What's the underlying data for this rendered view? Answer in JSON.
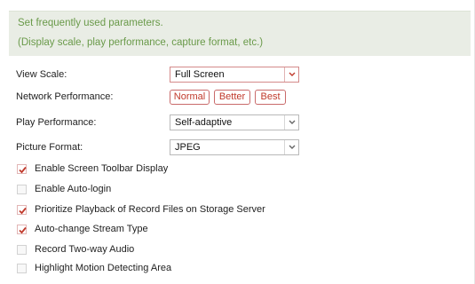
{
  "info": {
    "line1": "Set frequently used parameters.",
    "line2": "(Display scale, play performance, capture format, etc.)"
  },
  "view_scale": {
    "label": "View Scale:",
    "value": "Full Screen"
  },
  "network_performance": {
    "label": "Network Performance:",
    "options": [
      "Normal",
      "Better",
      "Best"
    ]
  },
  "play_performance": {
    "label": "Play Performance:",
    "value": "Self-adaptive"
  },
  "picture_format": {
    "label": "Picture Format:",
    "value": "JPEG"
  },
  "options": {
    "screen_toolbar": {
      "label": "Enable Screen Toolbar Display",
      "checked": true
    },
    "auto_login": {
      "label": "Enable Auto-login",
      "checked": false
    },
    "prioritize_playback": {
      "label": "Prioritize Playback of Record Files on Storage Server",
      "checked": true
    },
    "auto_change_stream": {
      "label": "Auto-change Stream Type",
      "checked": true
    },
    "two_way_audio": {
      "label": "Record Two-way Audio",
      "checked": false
    },
    "highlight_motion": {
      "label": "Highlight Motion Detecting Area",
      "checked": false
    }
  },
  "colors": {
    "accent_red": "#c0392b",
    "info_text_green": "#6a9a4a",
    "info_background": "#e9ede5"
  }
}
